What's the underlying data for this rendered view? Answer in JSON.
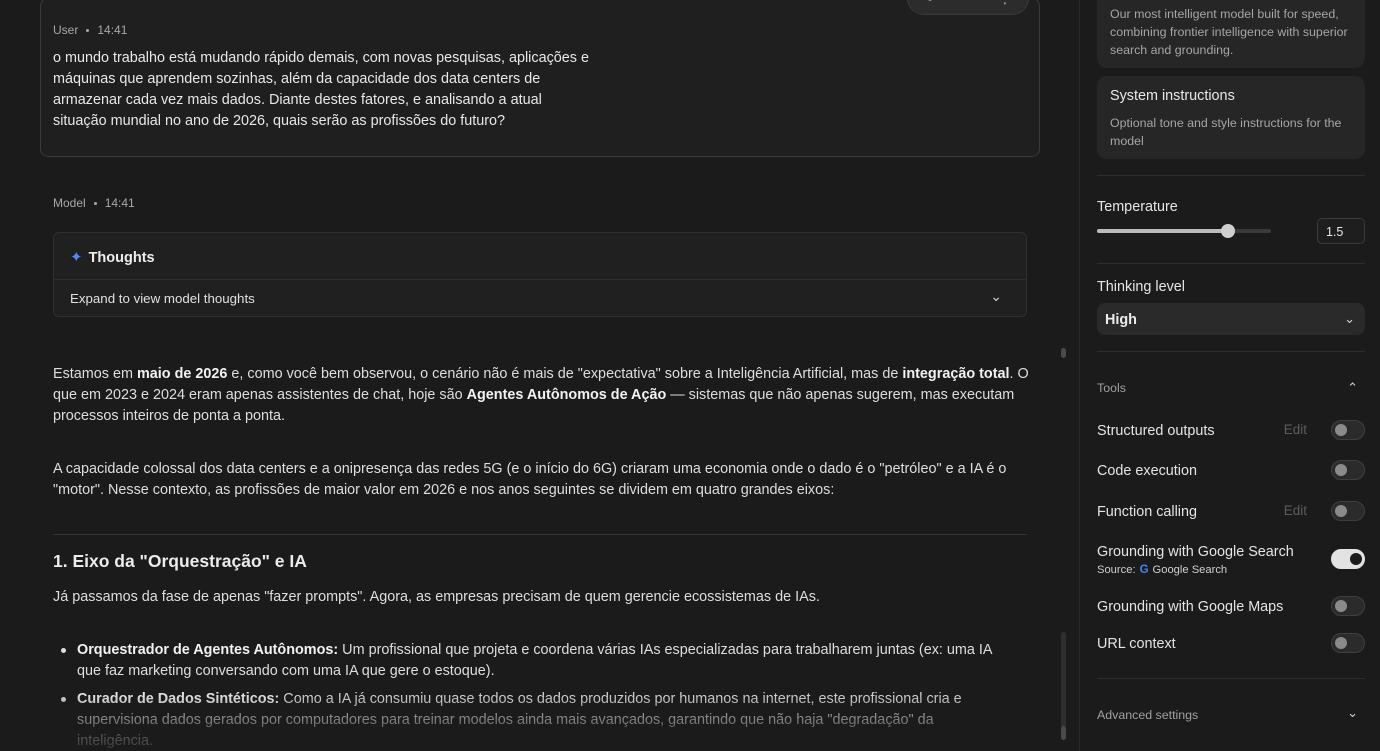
{
  "user_message": {
    "role": "User",
    "time": "14:41",
    "lines": [
      "o mundo trabalho está mudando rápido demais, com novas pesquisas, aplicações e",
      "máquinas que aprendem sozinhas, além da capacidade dos data centers de",
      "armazenar cada vez mais dados. Diante destes fatores, e analisando a atual",
      "situação mundial no ano de 2026, quais serão as profissões do futuro?"
    ]
  },
  "model_message": {
    "role": "Model",
    "time": "14:41",
    "thoughts": {
      "title": "Thoughts",
      "expand_label": "Expand to view model thoughts"
    },
    "p1": {
      "t1": "Estamos em ",
      "b1": "maio de 2026",
      "t2": " e, como você bem observou, o cenário não é mais de \"expectativa\" sobre a Inteligência Artificial, mas de ",
      "b2": "integração total",
      "t3": ". O que em 2023 e 2024 eram apenas assistentes de chat, hoje são ",
      "b3": "Agentes Autônomos de Ação",
      "t4": " — sistemas que não apenas sugerem, mas executam processos inteiros de ponta a ponta."
    },
    "p2": "A capacidade colossal dos data centers e a onipresença das redes 5G (e o início do 6G) criaram uma economia onde o dado é o \"petróleo\" e a IA é o \"motor\". Nesse contexto, as profissões de maior valor em 2026 e nos anos seguintes se dividem em quatro grandes eixos:",
    "section_title": "1. Eixo da \"Orquestração\" e IA",
    "section_intro": "Já passamos da fase de apenas \"fazer prompts\". Agora, as empresas precisam de quem gerencie ecossistemas de IAs.",
    "bullets": [
      {
        "term": "Orquestrador de Agentes Autônomos:",
        "text": " Um profissional que projeta e coordena várias IAs especializadas para trabalharem juntas (ex: uma IA que faz marketing conversando com uma IA que gere o estoque)."
      },
      {
        "term": "Curador de Dados Sintéticos:",
        "text": " Como a IA já consumiu quase todos os dados produzidos por humanos na internet, este profissional cria e supervisiona dados gerados por computadores para treinar modelos ainda mais avançados, garantindo que não haja \"degradação\" da inteligência."
      }
    ]
  },
  "settings": {
    "model_card_desc": "Our most intelligent model built for speed, combining frontier intelligence with superior search and grounding.",
    "system_instructions": {
      "title": "System instructions",
      "desc": "Optional tone and style instructions for the model"
    },
    "temperature": {
      "label": "Temperature",
      "value": "1.5",
      "fraction": 0.75
    },
    "thinking_level": {
      "label": "Thinking level",
      "value": "High"
    },
    "tools": {
      "label": "Tools",
      "edit_label": "Edit",
      "structured_outputs": "Structured outputs",
      "code_execution": "Code execution",
      "function_calling": "Function calling",
      "grounding_search": "Grounding with Google Search",
      "source_label": "Source:",
      "source_value": "Google Search",
      "grounding_maps": "Grounding with Google Maps",
      "url_context": "URL context",
      "states": {
        "structured_outputs": false,
        "code_execution": false,
        "function_calling": false,
        "grounding_search": true,
        "grounding_maps": false,
        "url_context": false
      }
    },
    "advanced_settings": "Advanced settings"
  },
  "colors": {
    "accent_spark": "#4b8df8",
    "background": "#1b1b1b",
    "card": "#262626"
  }
}
